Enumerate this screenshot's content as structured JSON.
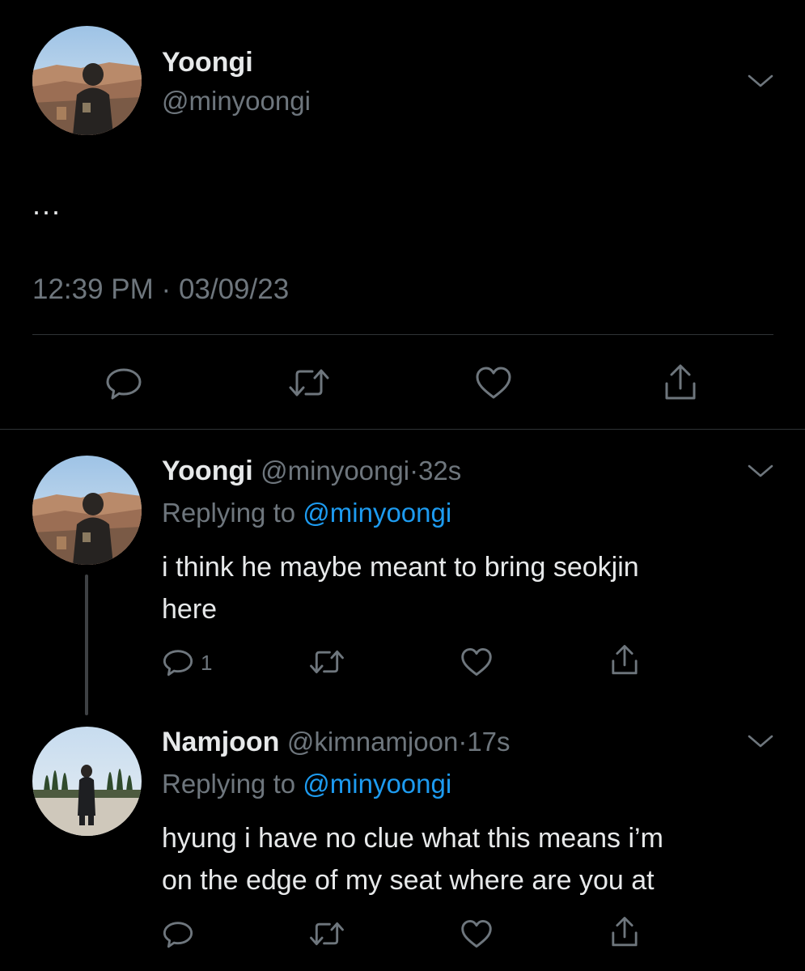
{
  "main_tweet": {
    "author_name": "Yoongi",
    "handle": "@minyoongi",
    "text": "...",
    "time": "12:39 PM",
    "separator": "·",
    "date": "03/09/23"
  },
  "replies": [
    {
      "author_name": "Yoongi",
      "handle": "@minyoongi",
      "separator": "·",
      "age": "32s",
      "replying_prefix": "Replying to",
      "replying_to": "@minyoongi",
      "text_line1": "i think he maybe meant to bring seokjin",
      "text_line2": "here",
      "reply_count": "1"
    },
    {
      "author_name": "Namjoon",
      "handle": "@kimnamjoon",
      "separator": "·",
      "age": "17s",
      "replying_prefix": "Replying to",
      "replying_to": "@minyoongi",
      "text_line1": "hyung i have no clue what this means i’m",
      "text_line2": "on the edge of my seat where are you at",
      "reply_count": ""
    }
  ],
  "icons": {
    "reply": "reply-icon",
    "retweet": "retweet-icon",
    "like": "heart-icon",
    "share": "share-icon",
    "more": "chevron-down-icon"
  },
  "colors": {
    "background": "#000000",
    "text": "#e7e9ea",
    "secondary": "#6e767d",
    "link": "#1d9bf0",
    "divider": "#2f3336"
  }
}
